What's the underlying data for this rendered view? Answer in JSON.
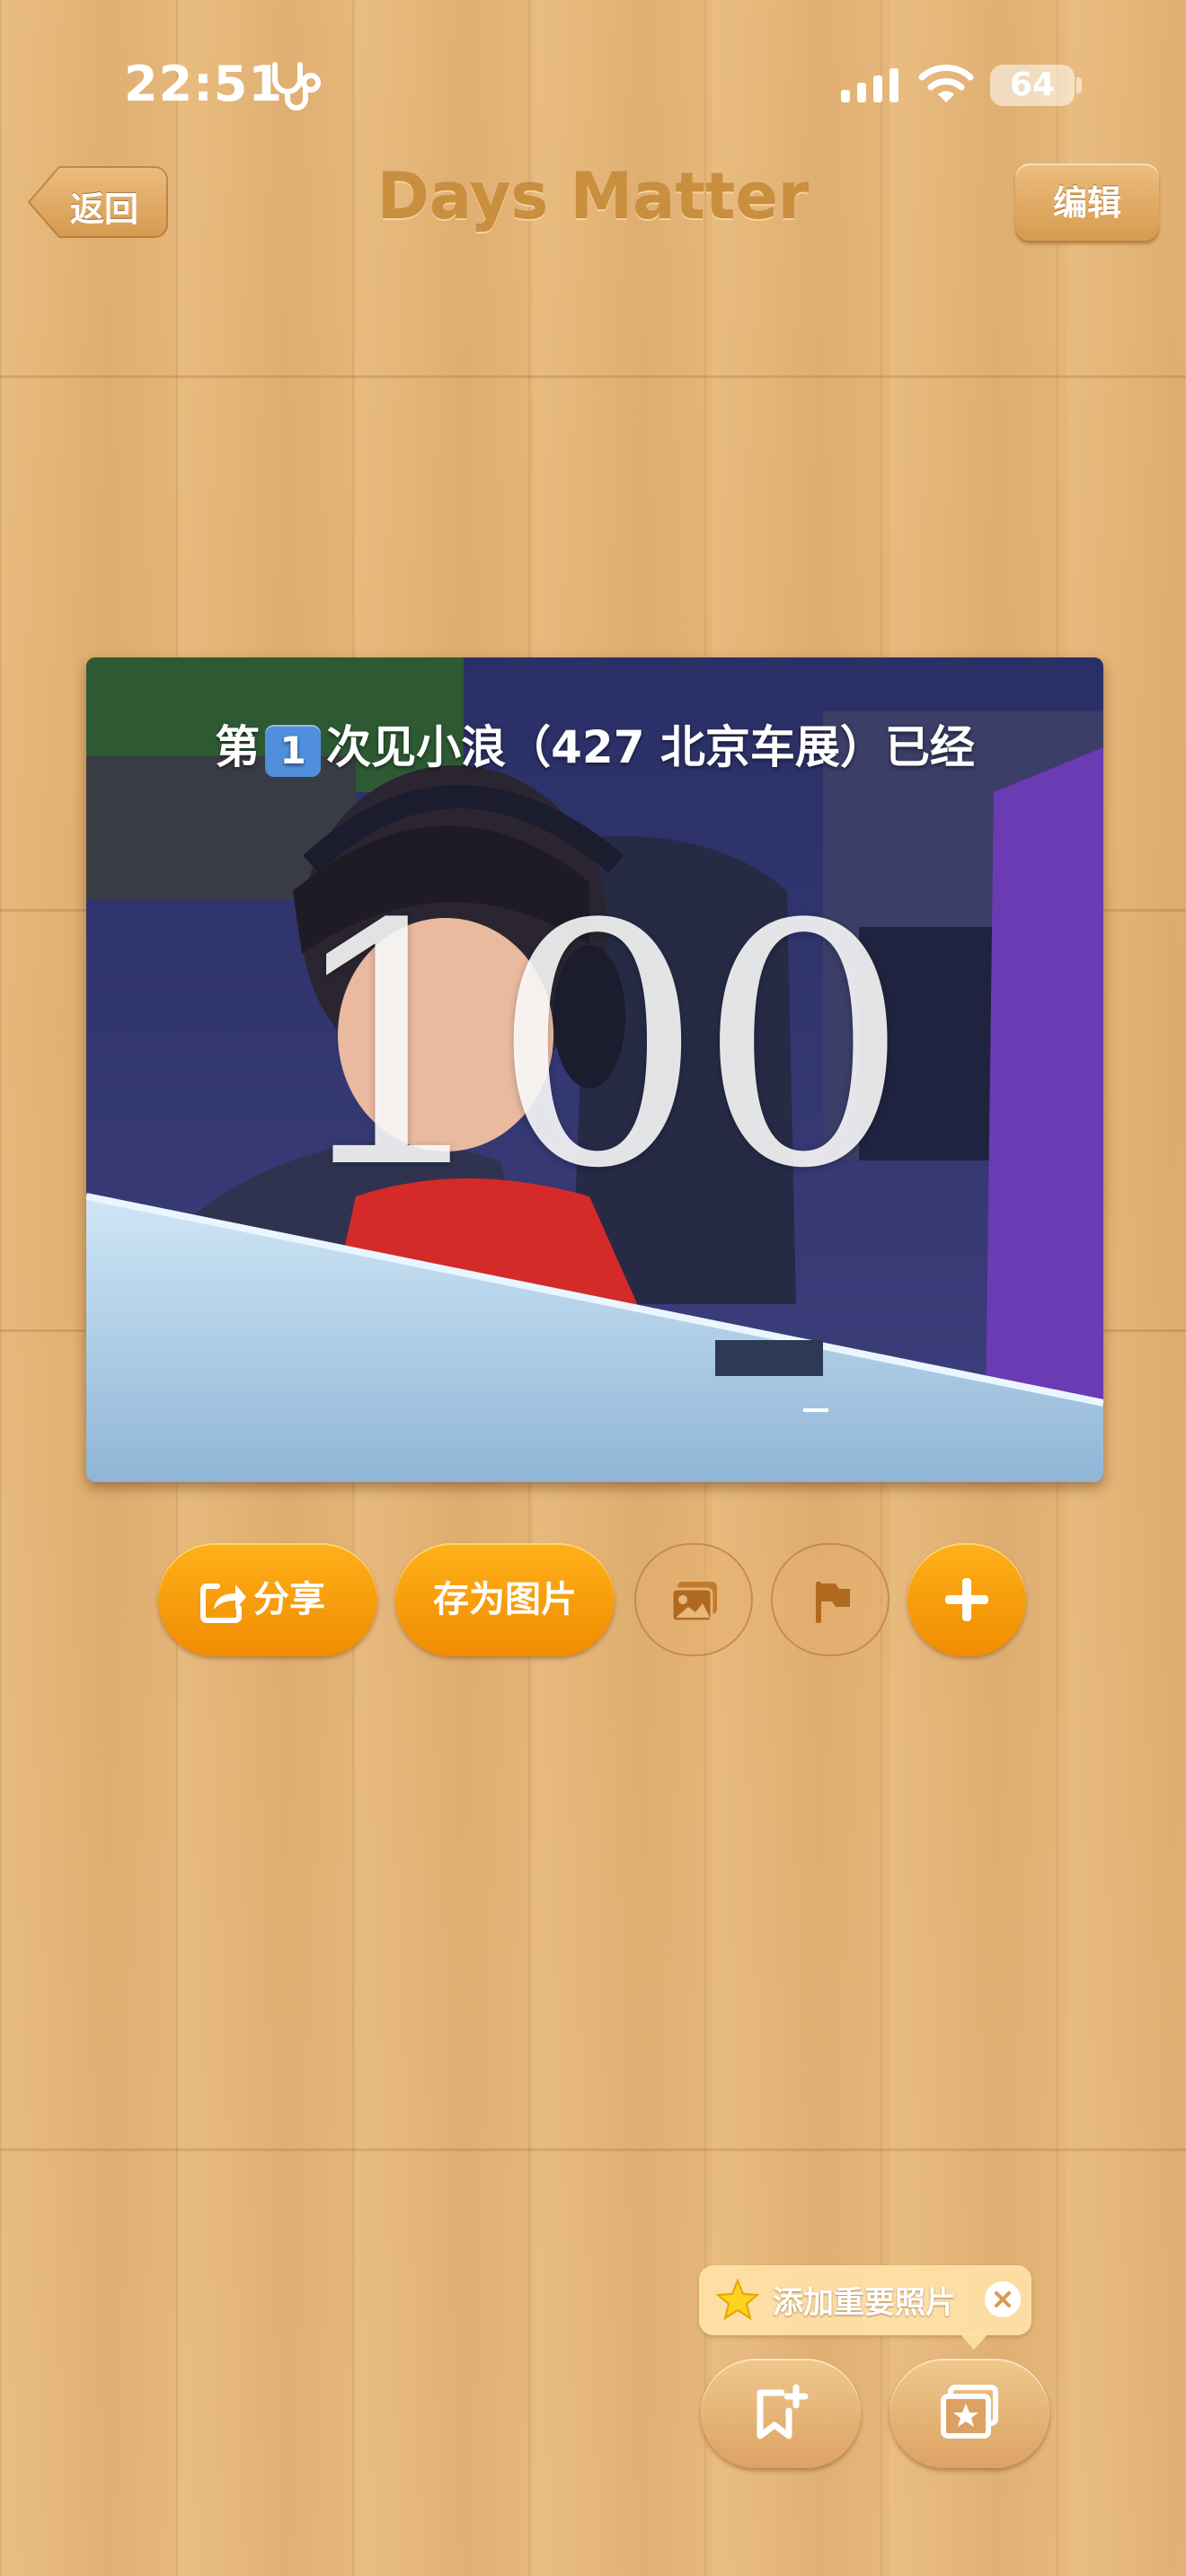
{
  "status_bar": {
    "time": "22:51",
    "battery": "64",
    "icons": [
      "stethoscope-icon",
      "signal-icon",
      "wifi-icon",
      "battery-icon"
    ]
  },
  "nav": {
    "back_label": "返回",
    "title": "Days Matter",
    "edit_label": "编辑"
  },
  "card": {
    "title_before": "第",
    "title_number": "1",
    "title_after": "次见小浪（427 北京车展）已经",
    "count": "100"
  },
  "actions": {
    "share_label": "分享",
    "save_image_label": "存为图片",
    "icons": [
      "photo-icon",
      "flag-icon",
      "plus-icon"
    ]
  },
  "tooltip": {
    "label": "添加重要照片"
  },
  "bottom_buttons": {
    "icons": [
      "bookmark-add-icon",
      "photo-frame-star-icon"
    ]
  },
  "colors": {
    "accent_orange": "#f5990a",
    "title_brown": "#c98f3e",
    "number_badge_blue": "#4f8fdc"
  }
}
